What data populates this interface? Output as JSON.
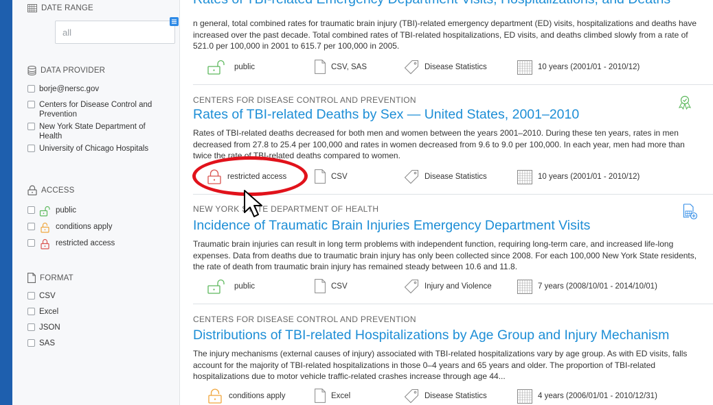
{
  "sidebar": {
    "date_range": {
      "label": "DATE RANGE",
      "value": "all"
    },
    "data_provider": {
      "label": "DATA PROVIDER",
      "items": [
        "borje@nersc.gov",
        "Centers for Disease Control and Prevention",
        "New York State Department of Health",
        "University of Chicago Hospitals"
      ]
    },
    "access": {
      "label": "ACCESS",
      "items": [
        "public",
        "conditions apply",
        "restricted access"
      ]
    },
    "format": {
      "label": "FORMAT",
      "items": [
        "CSV",
        "Excel",
        "JSON",
        "SAS"
      ]
    }
  },
  "results": [
    {
      "title": "Rates of TBI-related Emergency Department Visits, Hospitalizations, and Deaths",
      "description": "n general, total combined rates for traumatic brain injury (TBI)-related emergency department (ED) visits, hospitalizations and deaths have increased over the past decade. Total combined rates of TBI-related hospitalizations, ED visits, and deaths climbed slowly from a rate of 521.0 per 100,000 in 2001 to 615.7 per 100,000 in 2005.",
      "access": "public",
      "format": "CSV, SAS",
      "category": "Disease Statistics",
      "time": "10 years (2001/01 - 2010/12)"
    },
    {
      "agency": "CENTERS FOR DISEASE CONTROL AND PREVENTION",
      "title": "Rates of TBI-related Deaths by Sex — United States, 2001–2010",
      "description": "Rates of TBI-related deaths decreased for both men and women between the years 2001–2010. During these ten years, rates in men decreased from 27.8 to 25.4 per 100,000 and rates in women decreased from 9.6 to 9.0 per 100,000. In each year, men had more than twice the rate of TBI-related deaths compared to women.",
      "access": "restricted access",
      "format": "CSV",
      "category": "Disease Statistics",
      "time": "10 years (2001/01 - 2010/12)"
    },
    {
      "agency": "NEW YORK STATE DEPARTMENT OF HEALTH",
      "title": "Incidence of Traumatic Brain Injuries Emergency Department Visits",
      "description": "Traumatic brain injuries can result in long term problems with independent function, requiring long-term care, and increased life-long expenses. Data from deaths due to traumatic brain injury has only been collected since 2008. For each 100,000 New York State residents, the rate of death from traumatic brain injury has remained steady between 10.6 and 11.8.",
      "access": "public",
      "format": "CSV",
      "category": "Injury and Violence",
      "time": "7 years (2008/10/01 - 2014/10/01)"
    },
    {
      "agency": "CENTERS FOR DISEASE CONTROL AND PREVENTION",
      "title": "Distributions of TBI-related Hospitalizations by Age Group and Injury Mechanism",
      "description": "The injury mechanisms (external causes of injury) associated with TBI-related hospitalizations vary by age group. As with ED visits, falls account for the majority of TBI-related hospitalizations in those 0–4 years and 65 years and older. The proportion of TBI-related hospitalizations due to motor vehicle traffic-related crashes increase through age 44...",
      "access": "conditions apply",
      "format": "Excel",
      "category": "Disease Statistics",
      "time": "4 years (2006/01/01 - 2010/12/31)"
    }
  ],
  "colors": {
    "public": "#5cb85c",
    "conditions": "#f0a53a",
    "restricted": "#d9534f",
    "link": "#1d8ed6",
    "highlight": "#e1121b"
  }
}
